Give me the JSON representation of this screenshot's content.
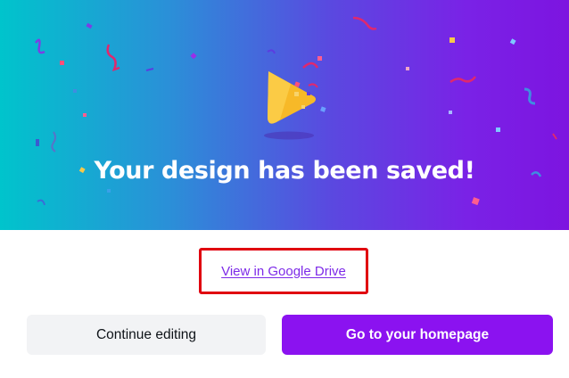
{
  "hero": {
    "title": "Your design has been saved!",
    "illustration_icon": "play-cone-icon",
    "gradient_start": "#00c4cc",
    "gradient_end": "#7d14e0"
  },
  "drive_link": {
    "label": "View in Google Drive",
    "color": "#7d2ae8",
    "highlight_color": "#e0000f"
  },
  "actions": {
    "continue_label": "Continue editing",
    "homepage_label": "Go to your homepage",
    "primary_color": "#8b12f0"
  }
}
